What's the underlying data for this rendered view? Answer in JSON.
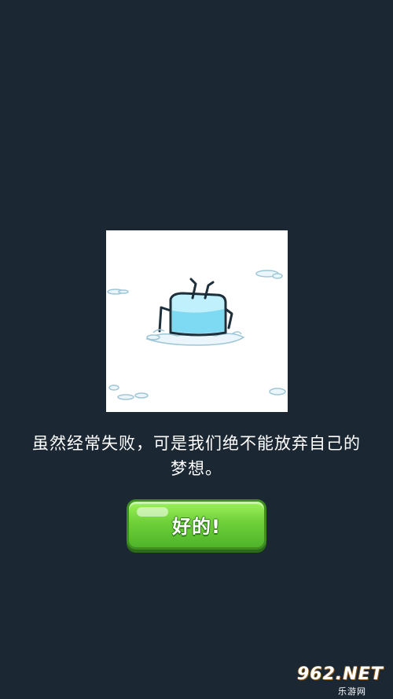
{
  "dialog": {
    "message": "虽然经常失败，可是我们绝不能放弃自己的梦想。",
    "ok_button_label": "好的!"
  },
  "watermark": {
    "brand": "962.NET",
    "subtitle": "乐游网"
  },
  "colors": {
    "background": "#1b2733",
    "button_green": "#6fd03a",
    "ice_blue": "#a8e8f8"
  },
  "icons": {
    "illustration": "ice-cube-sinking-in-snow-icon"
  }
}
